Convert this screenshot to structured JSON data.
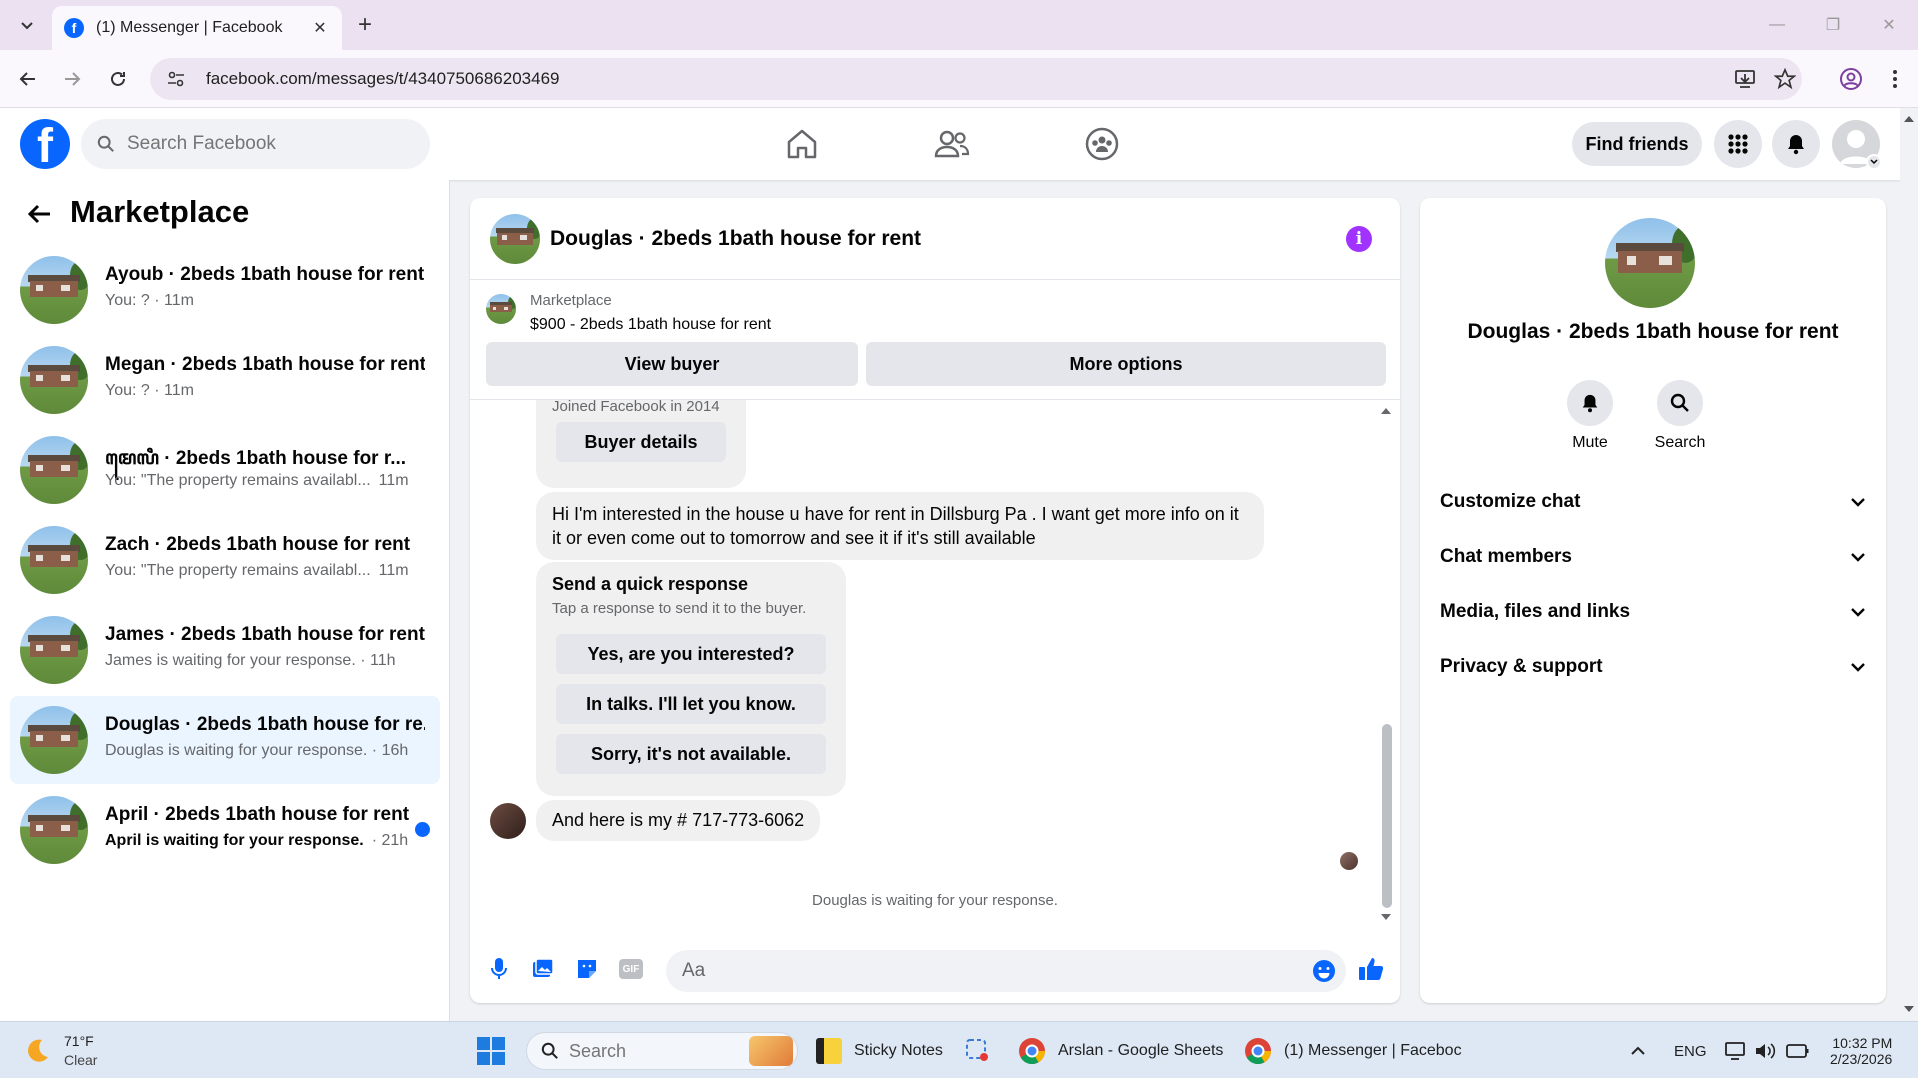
{
  "browser": {
    "tab_title": "(1) Messenger | Facebook",
    "url": "facebook.com/messages/t/4340750686203469"
  },
  "header": {
    "search_placeholder": "Search Facebook",
    "find_friends": "Find friends"
  },
  "sidebar": {
    "title": "Marketplace",
    "conversations": [
      {
        "name": "Ayoub · 2beds 1bath house for rent",
        "preview": "You: ? · 11m",
        "time": "",
        "unread": false,
        "active": false
      },
      {
        "name": "Megan · 2beds 1bath house for rent",
        "preview": "You: ? · 11m",
        "time": "",
        "unread": false,
        "active": false
      },
      {
        "name": "ꦩꦺꦭꦶ · 2beds 1bath house for r...",
        "preview": "You: \"The property remains availabl...",
        "time": "11m",
        "unread": false,
        "active": false
      },
      {
        "name": "Zach · 2beds 1bath house for rent",
        "preview": "You: \"The property remains availabl...",
        "time": "11m",
        "unread": false,
        "active": false
      },
      {
        "name": "James · 2beds 1bath house for rent",
        "preview": "James is waiting for your response. · 11h",
        "time": "",
        "unread": false,
        "active": false
      },
      {
        "name": "Douglas · 2beds 1bath house for re...",
        "preview": "Douglas is waiting for your response. · 16h",
        "time": "",
        "unread": false,
        "active": true
      },
      {
        "name": "April · 2beds 1bath house for rent",
        "preview": "April is waiting for your response.",
        "time": "· 21h",
        "unread": true,
        "active": false
      }
    ]
  },
  "chat": {
    "title": "Douglas · 2beds 1bath house for rent",
    "marketplace_label": "Marketplace",
    "listing": "$900 - 2beds 1bath house for rent",
    "view_buyer": "View buyer",
    "more_options": "More options",
    "joined_text": "Joined Facebook in 2014",
    "buyer_details": "Buyer details",
    "message_1": "Hi I'm interested in the house u have for rent in Dillsburg Pa . I want get more info on it it or even come out to tomorrow and see it if it's still available",
    "quick_title": "Send a quick response",
    "quick_subtitle": "Tap a response to send it to the buyer.",
    "quick_responses": [
      "Yes, are you interested?",
      "In talks. I'll let you know.",
      "Sorry, it's not available."
    ],
    "message_2": "And here is my # 717-773-6062",
    "waiting": "Douglas is waiting for your response.",
    "input_placeholder": "Aa",
    "gif_label": "GIF"
  },
  "info_panel": {
    "title": "Douglas · 2beds 1bath house for rent",
    "mute": "Mute",
    "search": "Search",
    "sections": [
      "Customize chat",
      "Chat members",
      "Media, files and links",
      "Privacy & support"
    ]
  },
  "taskbar": {
    "weather_temp": "71°F",
    "weather_desc": "Clear",
    "search_placeholder": "Search",
    "apps": [
      "Sticky Notes",
      "Arslan - Google Sheets",
      "(1) Messenger | Faceboc"
    ],
    "lang": "ENG",
    "time": "10:32 PM",
    "date": "2/23/2026"
  },
  "colors": {
    "fb_blue": "#0866ff",
    "active_conv_bg": "#ebf5ff",
    "info_purple": "#a033ff",
    "tab_bar": "#ebe1f1"
  }
}
